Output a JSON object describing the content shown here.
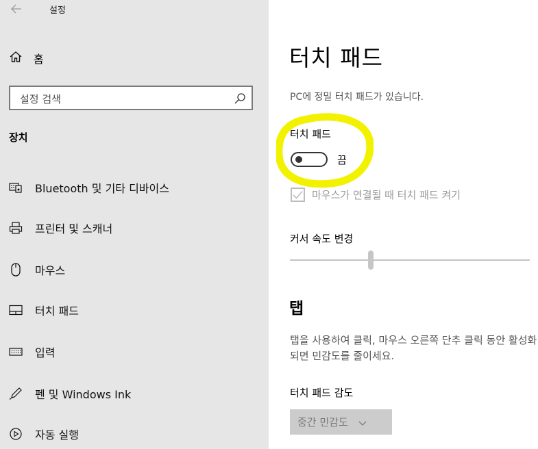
{
  "app": {
    "title": "설정"
  },
  "sidebar": {
    "home_label": "홈",
    "search_placeholder": "설정 검색",
    "section_title": "장치",
    "items": [
      {
        "label": "Bluetooth 및 기타 디바이스",
        "icon": "bluetooth-devices-icon"
      },
      {
        "label": "프린터 및 스캐너",
        "icon": "printer-icon"
      },
      {
        "label": "마우스",
        "icon": "mouse-icon"
      },
      {
        "label": "터치 패드",
        "icon": "touchpad-icon"
      },
      {
        "label": "입력",
        "icon": "keyboard-icon"
      },
      {
        "label": "펜 및 Windows Ink",
        "icon": "pen-icon"
      },
      {
        "label": "자동 실행",
        "icon": "autoplay-icon"
      }
    ]
  },
  "main": {
    "title": "터치 패드",
    "description": "PC에 정밀 터치 패드가 있습니다.",
    "touchpad_toggle": {
      "label": "터치 패드",
      "state_text": "끔",
      "on": false
    },
    "mouse_checkbox": {
      "label": "마우스가 연결될 때 터치 패드 켜기",
      "checked": true,
      "disabled": true
    },
    "cursor_speed": {
      "label": "커서 속도 변경",
      "value_fraction": 0.34
    },
    "tap_section": {
      "title": "탭",
      "description": "탭을 사용하여 클릭, 마우스 오른쪽 단추 클릭 동안 활성화되면 민감도를 줄이세요.",
      "sensitivity_label": "터치 패드 감도",
      "sensitivity_value": "중간 민감도"
    }
  },
  "colors": {
    "highlight": "#f2f200",
    "sidebar_bg": "#e6e6e6"
  }
}
